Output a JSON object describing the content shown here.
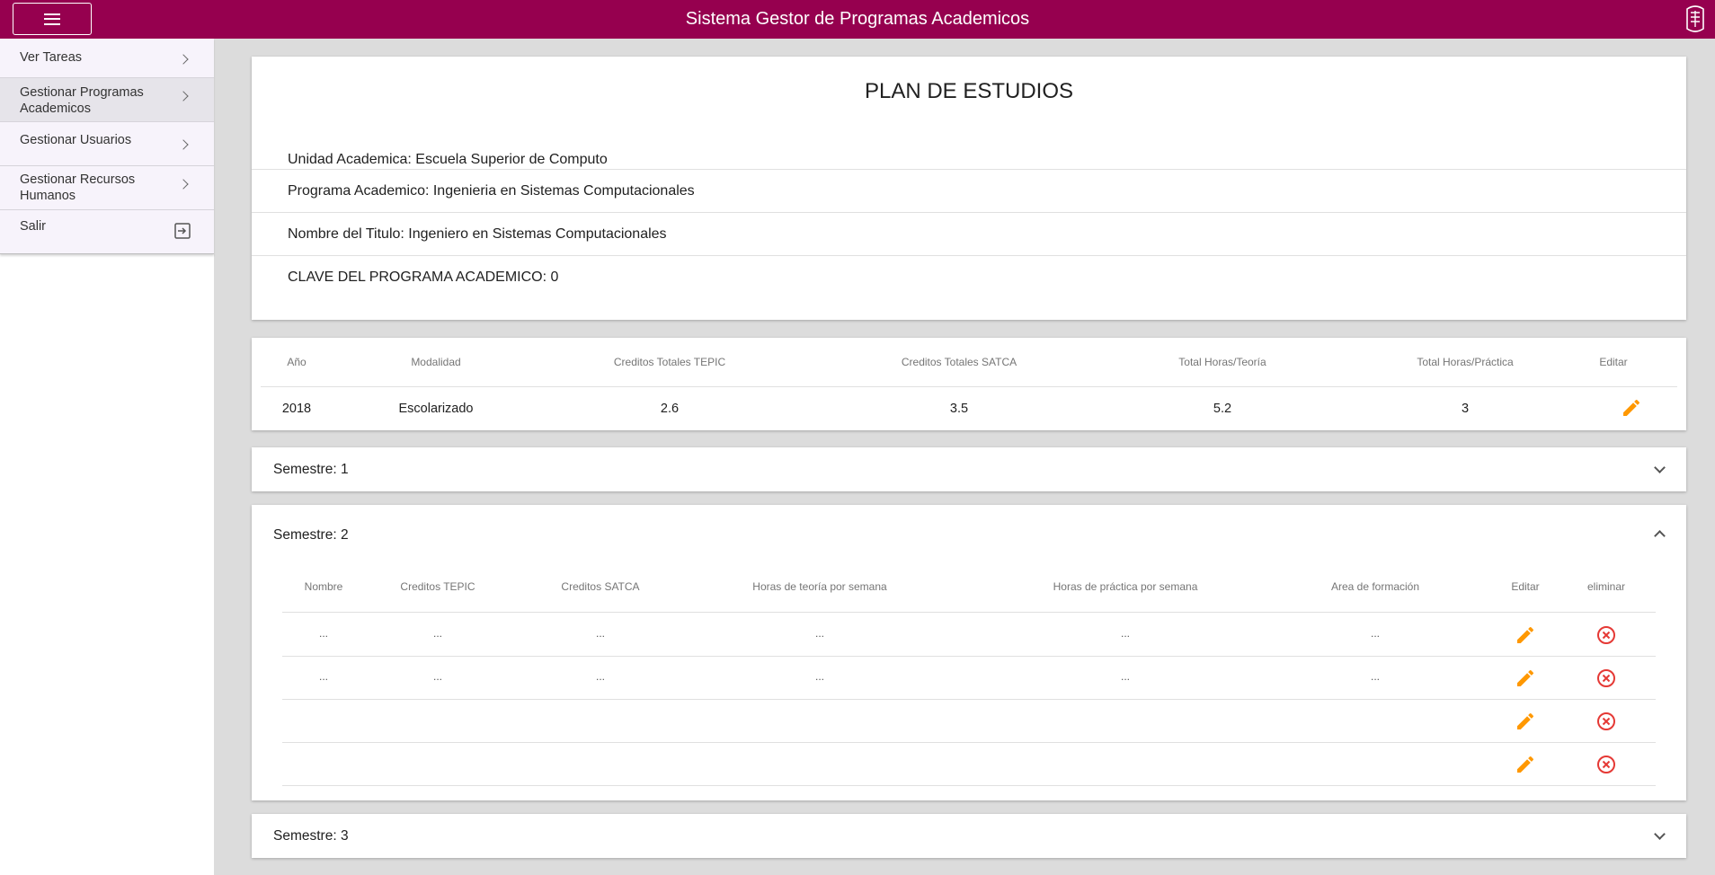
{
  "header": {
    "title": "Sistema Gestor de Programas Academicos",
    "color": "#96004f",
    "menu_icon": "hamburger-menu-icon",
    "logo_icon": "ipn-logo-icon"
  },
  "sidebar": {
    "items": [
      {
        "label": "Ver Tareas",
        "icon": "chevron-right-icon"
      },
      {
        "label": "Gestionar Programas\nAcademicos",
        "icon": "chevron-right-icon",
        "active": true
      },
      {
        "label": "Gestionar Usuarios",
        "icon": "chevron-right-icon"
      },
      {
        "label": "Gestionar Recursos\nHumanos",
        "icon": "chevron-right-icon"
      },
      {
        "label": "Salir",
        "icon": "exit-icon"
      }
    ]
  },
  "plan": {
    "title": "PLAN DE ESTUDIOS",
    "unidad": "Unidad Academica: Escuela Superior de Computo",
    "programa": "Programa Academico: Ingenieria en Sistemas Computacionales",
    "titulo": "Nombre del Titulo: Ingeniero en Sistemas Computacionales",
    "clave": "CLAVE DEL PROGRAMA ACADEMICO: 0"
  },
  "summary_table": {
    "headers": [
      "Año",
      "Modalidad",
      "Creditos Totales TEPIC",
      "Creditos Totales SATCA",
      "Total Horas/Teoría",
      "Total Horas/Práctica",
      "Editar"
    ],
    "row": [
      "2018",
      "Escolarizado",
      "2.6",
      "3.5",
      "5.2",
      "3"
    ]
  },
  "semesters": [
    {
      "label": "Semestre: 1",
      "expanded": false
    },
    {
      "label": "Semestre: 2",
      "expanded": true,
      "headers": [
        "Nombre",
        "Creditos TEPIC",
        "Creditos SATCA",
        "Horas de teoría por semana",
        "Horas de práctica por semana",
        "Area de formación",
        "Editar",
        "eliminar"
      ],
      "rows": [
        [
          "...",
          "...",
          "...",
          "...",
          "...",
          "..."
        ],
        [
          "...",
          "...",
          "...",
          "...",
          "...",
          "..."
        ],
        [
          "",
          "",
          "",
          "",
          "",
          ""
        ],
        [
          "",
          "",
          "",
          "",
          "",
          ""
        ]
      ]
    },
    {
      "label": "Semestre: 3",
      "expanded": false
    }
  ],
  "colors": {
    "edit": "#ff9800",
    "delete": "#e53935"
  }
}
